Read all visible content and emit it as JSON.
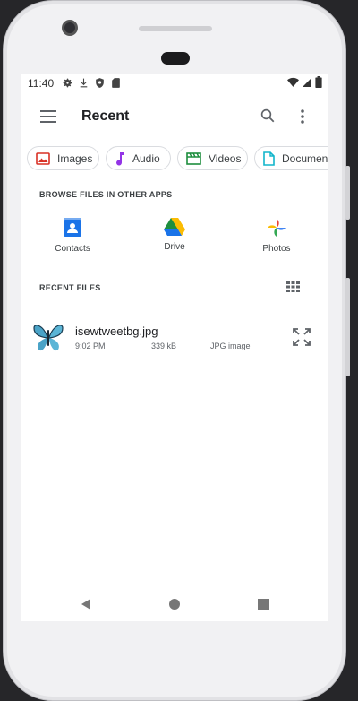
{
  "status": {
    "time": "11:40"
  },
  "toolbar": {
    "title": "Recent"
  },
  "chips": [
    {
      "label": "Images",
      "icon": "image-icon",
      "color": "#d93025"
    },
    {
      "label": "Audio",
      "icon": "music-note-icon",
      "color": "#9334e6"
    },
    {
      "label": "Videos",
      "icon": "movie-icon",
      "color": "#1e8e3e"
    },
    {
      "label": "Documen",
      "icon": "document-icon",
      "color": "#12b5cb"
    }
  ],
  "browse": {
    "heading": "BROWSE FILES IN OTHER APPS",
    "apps": [
      {
        "label": "Contacts",
        "icon": "contacts-icon"
      },
      {
        "label": "Drive",
        "icon": "drive-icon"
      },
      {
        "label": "Photos",
        "icon": "photos-icon"
      }
    ]
  },
  "recent": {
    "heading": "RECENT FILES",
    "files": [
      {
        "name": "isewtweetbg.jpg",
        "time": "9:02 PM",
        "size": "339 kB",
        "type": "JPG image",
        "thumb": "butterfly-thumbnail"
      }
    ]
  }
}
